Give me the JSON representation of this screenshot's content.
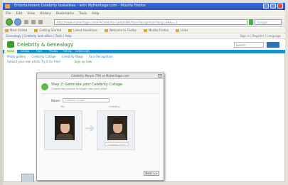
{
  "window": {
    "title": "Entertainment Celebrity lookalikes - with MyHeritage.com - Mozilla Firefox"
  },
  "menu": [
    "File",
    "Edit",
    "View",
    "History",
    "Bookmarks",
    "Tools",
    "Help"
  ],
  "address": {
    "url": "http://www.myheritage.com/FP/Celebrity-Lookalikes/Face-Recognition?lang=EN&s=1"
  },
  "browser_search": {
    "placeholder": "Google"
  },
  "bookmarks": [
    "Most Visited",
    "Getting Started",
    "Latest Headlines",
    "Welcome to Firefox",
    "Mozilla Firefox",
    "Links"
  ],
  "site": {
    "topbar": "Genealogy  |  Celebrity look-alikes  |  Tools  |  Help",
    "topbar_right": "Sign in  |  Register  |  Language",
    "brand": "Celebrity & Genealogy",
    "search_placeholder": "Search",
    "tabs": [
      "Home",
      "Celebs",
      "Face",
      "Photos",
      "Family",
      "Community"
    ],
    "subnav": [
      "Photo gallery",
      "Celebrity Collage",
      "Celebrity Blogs",
      "Face Recognition"
    ],
    "promo_prefix": "Upload your own photo",
    "promo_link": "Try it for free!",
    "promo_green": "Sign up now"
  },
  "dialog": {
    "title": "Celebrity Morph (TM) at MyHeritage.com",
    "heading": "Step 2: Generate your Celebrity Collage",
    "description": "Choose two photos to morph into each other",
    "name_label": "Name:",
    "name_value": "Celebrity morph",
    "left_label": "You",
    "right_label": "Celebrity",
    "caption": "Celebrity name",
    "next_button": "Next >>"
  }
}
